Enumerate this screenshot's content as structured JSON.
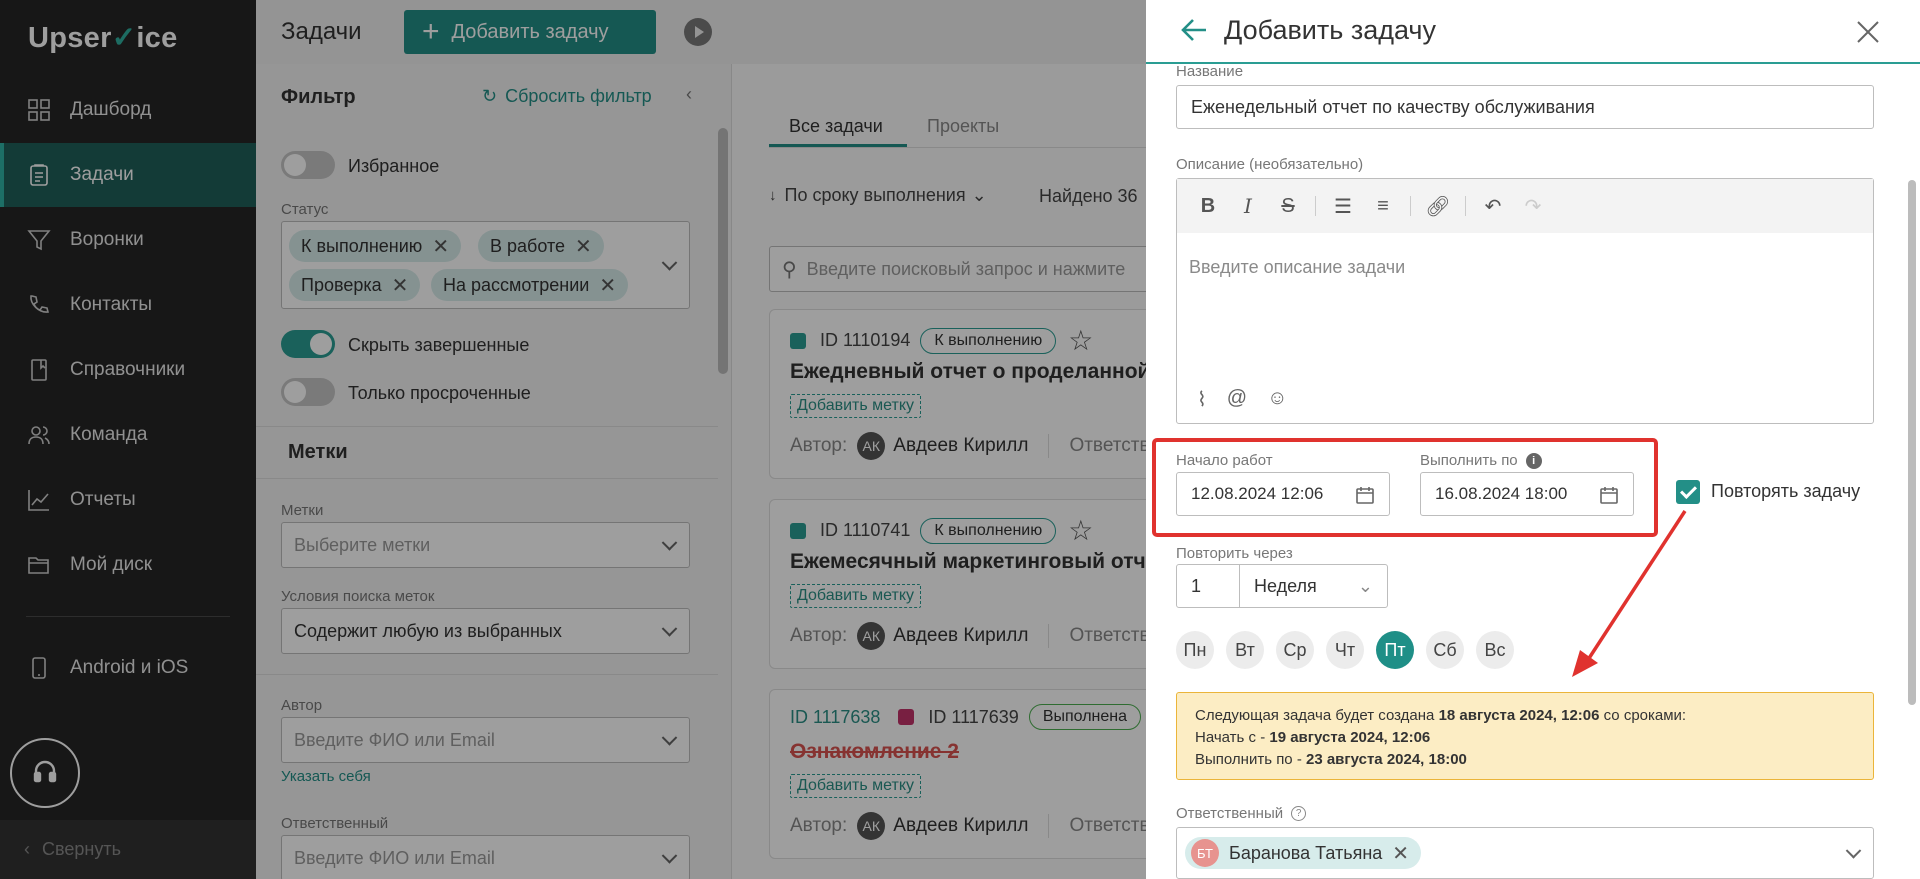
{
  "sidebar": {
    "logo_left": "Upser",
    "logo_v": "V",
    "logo_right": "ice",
    "items": [
      {
        "label": "Дашборд",
        "icon": "dashboard-icon"
      },
      {
        "label": "Задачи",
        "icon": "tasks-icon",
        "active": true
      },
      {
        "label": "Воронки",
        "icon": "funnel-icon"
      },
      {
        "label": "Контакты",
        "icon": "contacts-icon"
      },
      {
        "label": "Справочники",
        "icon": "book-icon"
      },
      {
        "label": "Команда",
        "icon": "team-icon"
      },
      {
        "label": "Отчеты",
        "icon": "chart-icon"
      },
      {
        "label": "Мой диск",
        "icon": "folder-icon"
      }
    ],
    "mobile": "Android и iOS",
    "collapse": "Свернуть"
  },
  "topbar": {
    "title": "Задачи",
    "add_button": "Добавить задачу"
  },
  "filter": {
    "title": "Фильтр",
    "reset": "Сбросить фильтр",
    "favorites": "Избранное",
    "status_label": "Статус",
    "status_chips": [
      "К выполнению",
      "В работе",
      "Проверка",
      "На рассмотрении"
    ],
    "hide_completed": "Скрыть завершенные",
    "only_overdue": "Только просроченные",
    "tags_section": "Метки",
    "tags_label": "Метки",
    "tags_placeholder": "Выберите метки",
    "search_cond_label": "Условия поиска меток",
    "search_cond_value": "Содержит любую из выбранных",
    "author_label": "Автор",
    "author_placeholder": "Введите ФИО или Email",
    "set_self": "Указать себя",
    "responsible_label": "Ответственный",
    "responsible_placeholder": "Введите ФИО или Email"
  },
  "list": {
    "tabs": [
      "Все задачи",
      "Проекты"
    ],
    "sort": "По сроку выполнения",
    "found": "Найдено 36",
    "search_placeholder": "Введите поисковый запрос и нажмите",
    "cards": [
      {
        "id": "ID 1110194",
        "status": "К выполнению",
        "title": "Ежедневный отчет о проделанной",
        "add_tag": "Добавить метку",
        "author_label": "Автор:",
        "author_initials": "АК",
        "author": "Авдеев Кирилл",
        "responsible_label": "Ответств"
      },
      {
        "id": "ID 1110741",
        "status": "К выполнению",
        "title": "Ежемесячный маркетинговый отче",
        "add_tag": "Добавить метку",
        "author_label": "Автор:",
        "author_initials": "АК",
        "author": "Авдеев Кирилл",
        "responsible_label": "Ответств"
      },
      {
        "parent_id": "ID 1117638",
        "id": "ID 1117639",
        "status": "Выполнена",
        "title": "Ознакомление 2",
        "add_tag": "Добавить метку",
        "author_label": "Автор:",
        "author_initials": "АК",
        "author": "Авдеев Кирилл",
        "responsible_label": "Ответств"
      }
    ]
  },
  "modal": {
    "title": "Добавить задачу",
    "name_label": "Название",
    "name_value": "Еженедельный отчет по качеству обслуживания",
    "desc_label": "Описание (необязательно)",
    "desc_placeholder": "Введите описание задачи",
    "start_label": "Начало работ",
    "start_value": "12.08.2024 12:06",
    "due_label": "Выполнить по",
    "due_value": "16.08.2024 18:00",
    "repeat_label": "Повторять задачу",
    "repeat_checked": true,
    "repeat_every_label": "Повторить через",
    "repeat_count": "1",
    "repeat_unit": "Неделя",
    "days": [
      "Пн",
      "Вт",
      "Ср",
      "Чт",
      "Пт",
      "Сб",
      "Вс"
    ],
    "selected_day": "Пт",
    "notice": {
      "l1_pre": "Следующая задача будет создана ",
      "l1_bold": "18 августа 2024, 12:06",
      "l1_post": " со сроками:",
      "l2_pre": "Начать с - ",
      "l2_bold": "19 августа 2024, 12:06",
      "l3_pre": "Выполнить по - ",
      "l3_bold": "23 августа 2024, 18:00"
    },
    "responsible_label": "Ответственный",
    "responsible_initials": "БТ",
    "responsible_name": "Баранова Татьяна"
  },
  "colors": {
    "accent": "#238f87",
    "highlight": "#e0322e",
    "notice_bg": "#fcedc4"
  }
}
